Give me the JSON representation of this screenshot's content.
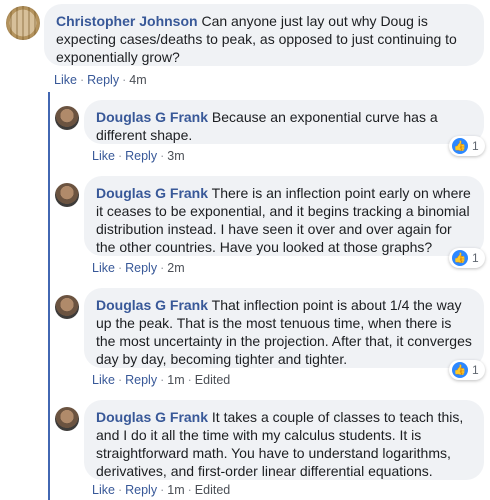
{
  "comments": [
    {
      "author": "Christopher Johnson",
      "text": "Can anyone just lay out why Doug is expecting cases/deaths to peak, as opposed to just continuing to exponentially grow?",
      "like": "Like",
      "reply": "Reply",
      "time": "4m"
    }
  ],
  "replies": [
    {
      "author": "Douglas G Frank",
      "text": "Because an exponential curve has a different shape.",
      "like": "Like",
      "reply": "Reply",
      "time": "3m",
      "edited": "",
      "reactions": "1"
    },
    {
      "author": "Douglas G Frank",
      "text": "There is an inflection point early on where it ceases to be exponential, and it begins tracking a binomial distribution instead. I have seen it over and over again for the other countries. Have you looked at those graphs?",
      "like": "Like",
      "reply": "Reply",
      "time": "2m",
      "edited": "",
      "reactions": "1"
    },
    {
      "author": "Douglas G Frank",
      "text": "That inflection point is about 1/4 the way up the peak. That is the most tenuous time, when there is the most uncertainty in the projection. After that, it converges day by day, becoming tighter and tighter.",
      "like": "Like",
      "reply": "Reply",
      "time": "1m",
      "edited": "Edited",
      "reactions": "1"
    },
    {
      "author": "Douglas G Frank",
      "text": "It takes a couple of classes to teach this, and I do it all the time with my calculus students. It is straightforward math. You have to understand logarithms, derivatives, and first-order linear differential equations.",
      "like": "Like",
      "reply": "Reply",
      "time": "1m",
      "edited": "Edited",
      "reactions": ""
    }
  ],
  "colors": {
    "bubble": "#f0f2f5",
    "name": "#385898",
    "like_icon": "#2d88ff",
    "thread_line": "#4267b2"
  }
}
